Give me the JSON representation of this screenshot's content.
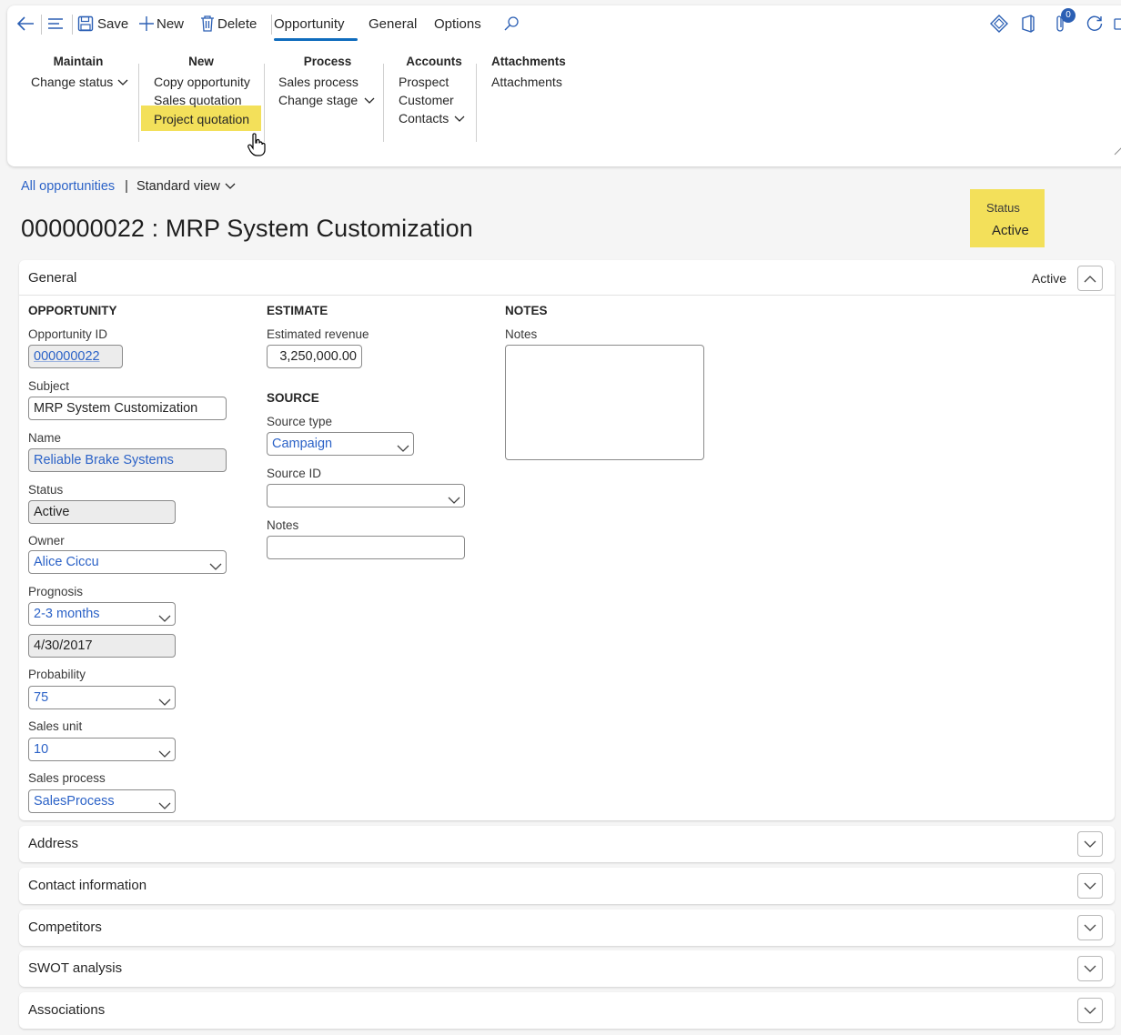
{
  "toolbar": {
    "save": "Save",
    "new": "New",
    "delete": "Delete",
    "tabs": [
      "Opportunity",
      "General",
      "Options"
    ],
    "active_tab": "Opportunity",
    "notification_count": "0"
  },
  "ribbon": {
    "maintain": {
      "title": "Maintain",
      "items": [
        "Change status"
      ]
    },
    "new": {
      "title": "New",
      "items": [
        "Copy opportunity",
        "Sales quotation",
        "Project quotation"
      ]
    },
    "process": {
      "title": "Process",
      "items": [
        "Sales process",
        "Change stage"
      ]
    },
    "accounts": {
      "title": "Accounts",
      "items": [
        "Prospect",
        "Customer",
        "Contacts"
      ]
    },
    "attachments": {
      "title": "Attachments",
      "items": [
        "Attachments"
      ]
    }
  },
  "breadcrumb": {
    "link": "All opportunities",
    "separator": "|",
    "view": "Standard view"
  },
  "page_title": "000000022 : MRP System Customization",
  "status_box": {
    "label": "Status",
    "value": "Active"
  },
  "general": {
    "title": "General",
    "summary": "Active",
    "opportunity": {
      "heading": "OPPORTUNITY",
      "id_label": "Opportunity ID",
      "id": "000000022",
      "subject_label": "Subject",
      "subject": "MRP System Customization",
      "name_label": "Name",
      "name": "Reliable Brake Systems",
      "status_label": "Status",
      "status": "Active",
      "owner_label": "Owner",
      "owner": "Alice Ciccu",
      "prognosis_label": "Prognosis",
      "prognosis": "2-3 months",
      "prognosis_date": "4/30/2017",
      "probability_label": "Probability",
      "probability": "75",
      "sales_unit_label": "Sales unit",
      "sales_unit": "10",
      "sales_process_label": "Sales process",
      "sales_process": "SalesProcess"
    },
    "estimate": {
      "heading": "ESTIMATE",
      "revenue_label": "Estimated revenue",
      "revenue": "3,250,000.00"
    },
    "source": {
      "heading": "SOURCE",
      "type_label": "Source type",
      "type": "Campaign",
      "id_label": "Source ID",
      "id": "",
      "notes_label": "Notes",
      "notes": ""
    },
    "notes": {
      "heading": "NOTES",
      "label": "Notes",
      "value": ""
    }
  },
  "fasttabs": [
    "Address",
    "Contact information",
    "Competitors",
    "SWOT analysis",
    "Associations"
  ],
  "colors": {
    "accent": "#0f6cbd",
    "link": "#2b62c7",
    "highlight": "#f3e05a"
  }
}
